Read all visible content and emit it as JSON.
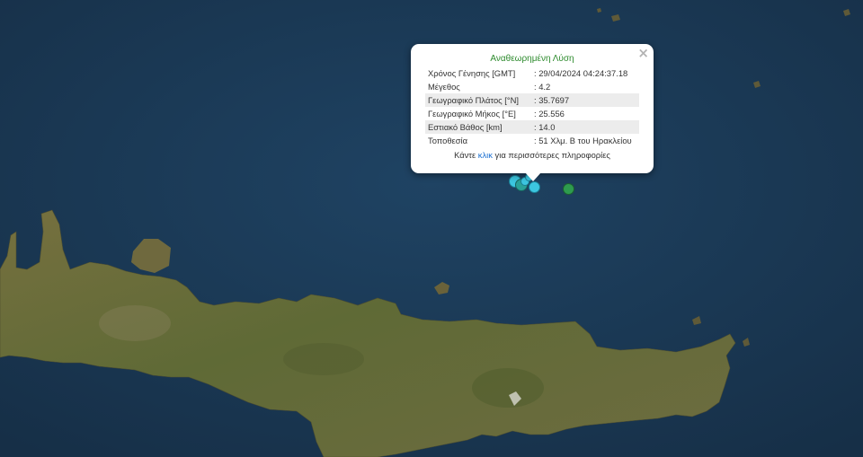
{
  "popup": {
    "title": "Αναθεωρημένη Λύση",
    "close_icon": "×",
    "rows": [
      {
        "label": "Χρόνος Γένησης [GMT]",
        "value": ": 29/04/2024 04:24:37.18"
      },
      {
        "label": "Μέγεθος",
        "value": ": 4.2"
      },
      {
        "label": "Γεωγραφικό Πλάτος [°N]",
        "value": ": 35.7697"
      },
      {
        "label": "Γεωγραφικό Μήκος [°E]",
        "value": ": 25.556"
      },
      {
        "label": "Εστιακό Βάθος [km]",
        "value": ": 14.0"
      },
      {
        "label": "Τοποθεσία",
        "value": ": 51 Χλμ. Β του Ηρακλείου"
      }
    ],
    "more_prefix": "Κάντε ",
    "more_link": "κλικ",
    "more_suffix": " για περισσότερες πληροφορίες"
  },
  "colors": {
    "sea": "#1b3a55",
    "land": "#6b6a3e",
    "title_green": "#2e8b2e",
    "link_blue": "#1a6fd1",
    "marker_cyan": "#3cc6e0",
    "marker_teal": "#2aa198",
    "marker_green": "#2e9b4e"
  }
}
